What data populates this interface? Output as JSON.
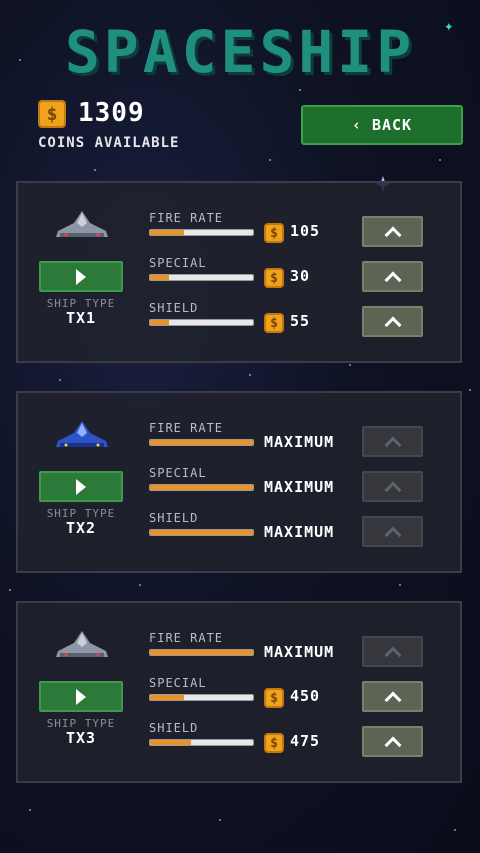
{
  "header": {
    "title": "SPACESHIP",
    "coins": "1309",
    "coins_label": "COINS AVAILABLE",
    "coin_symbol": "$",
    "back_label": "BACK",
    "back_arrow": "‹"
  },
  "colors": {
    "title": "#1f8f80",
    "coin": "#f0a21c",
    "bar_fill": "#e8942a",
    "play_button": "#2c7a3a",
    "back_button": "#1e6e2c"
  },
  "ship_type_label": "SHIP TYPE",
  "stat_labels": {
    "fire_rate": "FIRE RATE",
    "special": "SPECIAL",
    "shield": "SHIELD"
  },
  "ships": [
    {
      "name": "TX1",
      "stats": {
        "fire_rate": {
          "level": 0.33,
          "price": "105",
          "maxed": false
        },
        "special": {
          "level": 0.18,
          "price": "30",
          "maxed": false
        },
        "shield": {
          "level": 0.18,
          "price": "55",
          "maxed": false
        }
      }
    },
    {
      "name": "TX2",
      "stats": {
        "fire_rate": {
          "level": 1.0,
          "price": "MAXIMUM",
          "maxed": true
        },
        "special": {
          "level": 1.0,
          "price": "MAXIMUM",
          "maxed": true
        },
        "shield": {
          "level": 1.0,
          "price": "MAXIMUM",
          "maxed": true
        }
      }
    },
    {
      "name": "TX3",
      "stats": {
        "fire_rate": {
          "level": 1.0,
          "price": "MAXIMUM",
          "maxed": true
        },
        "special": {
          "level": 0.33,
          "price": "450",
          "maxed": false
        },
        "shield": {
          "level": 0.4,
          "price": "475",
          "maxed": false
        }
      }
    }
  ]
}
